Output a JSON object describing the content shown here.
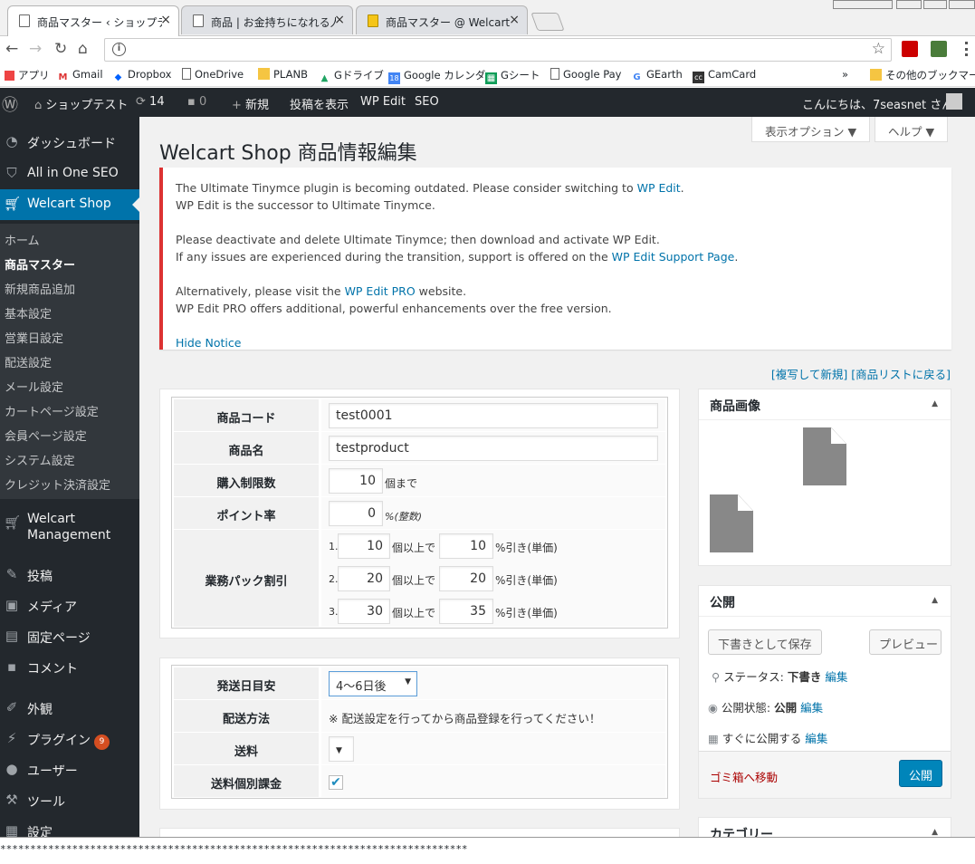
{
  "browser": {
    "tabs": [
      {
        "label": "商品マスター ‹ ショップテスト"
      },
      {
        "label": "商品 | お金持ちになれる人"
      },
      {
        "label": "商品マスター @ Welcart オ"
      }
    ],
    "bookmarks": [
      "アプリ",
      "Gmail",
      "Dropbox",
      "OneDrive",
      "PLANB",
      "Gドライブ",
      "Google カレンダ",
      "Gシート",
      "Google Pay",
      "GEarth",
      "CamCard",
      "»",
      "その他のブックマーク"
    ]
  },
  "adminbar": {
    "site": "ショップテスト",
    "updates": "14",
    "comments": "0",
    "new": "新規",
    "view": "投稿を表示",
    "wpedit": "WP Edit",
    "seo": "SEO",
    "greeting": "こんにちは、7seasnet さん！"
  },
  "sidebar": {
    "top": [
      {
        "label": "ダッシュボード",
        "icon": "dashboard-icon"
      },
      {
        "label": "All in One SEO",
        "icon": "shield-icon"
      },
      {
        "label": "Welcart Shop",
        "icon": "cart-icon"
      }
    ],
    "sub": [
      "ホーム",
      "商品マスター",
      "新規商品追加",
      "基本設定",
      "営業日設定",
      "配送設定",
      "メール設定",
      "カートページ設定",
      "会員ページ設定",
      "システム設定",
      "クレジット決済設定"
    ],
    "bottom": [
      {
        "label": "Welcart",
        "label2": "Management",
        "icon": "cart-icon"
      },
      {
        "label": "投稿",
        "icon": "pin-icon"
      },
      {
        "label": "メディア",
        "icon": "media-icon"
      },
      {
        "label": "固定ページ",
        "icon": "page-icon"
      },
      {
        "label": "コメント",
        "icon": "comment-icon"
      },
      {
        "label": "外観",
        "icon": "brush-icon"
      },
      {
        "label": "プラグイン",
        "icon": "plugin-icon",
        "badge": "9"
      },
      {
        "label": "ユーザー",
        "icon": "user-icon"
      },
      {
        "label": "ツール",
        "icon": "wrench-icon"
      },
      {
        "label": "設定",
        "icon": "settings-icon"
      }
    ]
  },
  "page": {
    "title": "Welcart Shop 商品情報編集",
    "screen_options": "表示オプション ▼",
    "help": "ヘルプ ▼",
    "notice": {
      "l1a": "The Ultimate Tinymce plugin is becoming outdated. Please consider switching to ",
      "l1link": "WP Edit",
      "l1b": ".",
      "l2": "WP Edit is the successor to Ultimate Tinymce.",
      "l3": "Please deactivate and delete Ultimate Tinymce; then download and activate WP Edit.",
      "l4a": "If any issues are experienced during the transition, support is offered on the ",
      "l4link": "WP Edit Support Page",
      "l4b": ".",
      "l5a": "Alternatively, please visit the ",
      "l5link": "WP Edit PRO",
      "l5b": " website.",
      "l6": "WP Edit PRO offers additional, powerful enhancements over the free version.",
      "hide": "Hide Notice"
    },
    "toplinks": "[複写して新規] [商品リストに戻る]",
    "form1": {
      "code_label": "商品コード",
      "code": "test0001",
      "name_label": "商品名",
      "name": "testproduct",
      "limit_label": "購入制限数",
      "limit": "10",
      "limit_unit": "個まで",
      "point_label": "ポイント率",
      "point": "0",
      "point_unit": "%(整数)",
      "discount_label": "業務パック割引",
      "discounts": [
        {
          "n": "1.",
          "qty": "10",
          "pct": "10"
        },
        {
          "n": "2.",
          "qty": "20",
          "pct": "20"
        },
        {
          "n": "3.",
          "qty": "30",
          "pct": "35"
        }
      ],
      "qty_unit": "個以上で",
      "pct_unit": "%引き(単価)"
    },
    "form2": {
      "ship_label": "発送日目安",
      "ship": "4〜6日後",
      "method_label": "配送方法",
      "method_note": "※ 配送設定を行ってから商品登録を行ってください！",
      "fee_label": "送料",
      "indiv_label": "送料個別課金"
    },
    "image_box": {
      "title": "商品画像"
    },
    "publish": {
      "title": "公開",
      "save": "下書きとして保存",
      "preview": "プレビュー",
      "status_label": "ステータス:",
      "status": "下書き",
      "visibility_label": "公開状態:",
      "visibility": "公開",
      "schedule": "すぐに公開する",
      "edit": "編集",
      "trash": "ゴミ箱へ移動",
      "publish": "公開"
    },
    "category": {
      "title": "カテゴリー"
    }
  },
  "footer_text": "******************************************************************************",
  "colors": {
    "accent": "#0073aa",
    "adminbar": "#23282d",
    "notice": "#dc3232"
  }
}
